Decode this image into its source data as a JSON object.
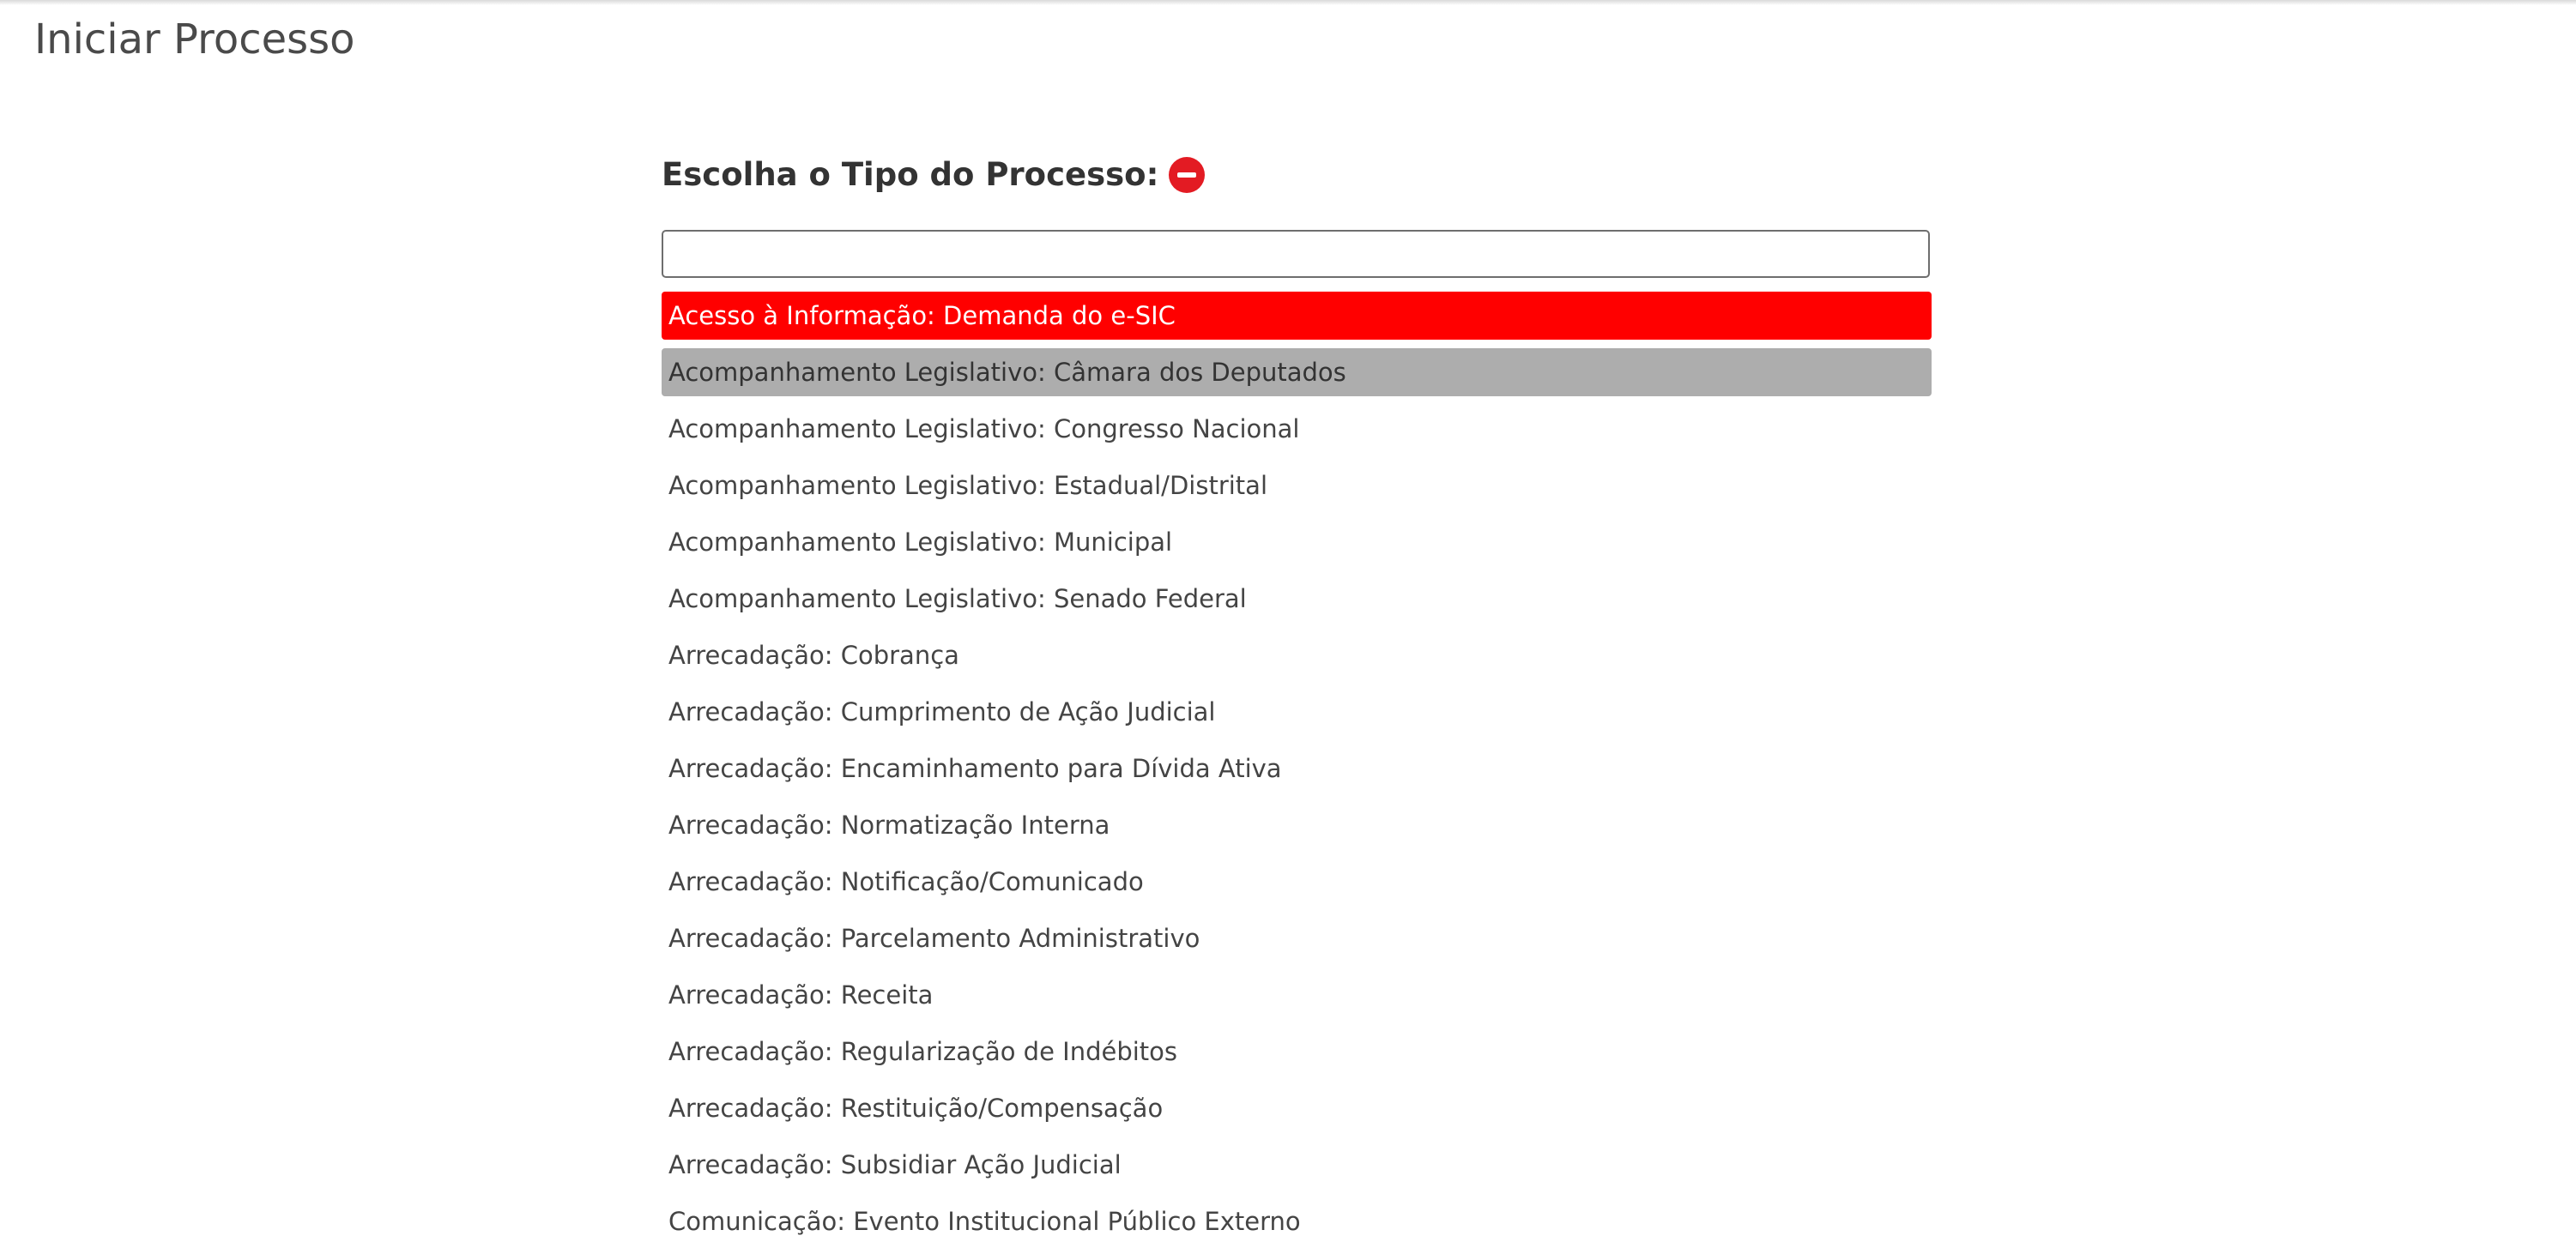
{
  "page": {
    "title": "Iniciar Processo"
  },
  "form": {
    "label": "Escolha o Tipo do Processo:",
    "toggle_icon": "minus-circle-icon",
    "search_value": "",
    "accent_color": "#ff0000",
    "hover_color": "#adadad"
  },
  "options": [
    {
      "label": "Acesso à Informação: Demanda do e-SIC",
      "state": "selected"
    },
    {
      "label": "Acompanhamento Legislativo: Câmara dos Deputados",
      "state": "hovered"
    },
    {
      "label": "Acompanhamento Legislativo: Congresso Nacional",
      "state": ""
    },
    {
      "label": "Acompanhamento Legislativo: Estadual/Distrital",
      "state": ""
    },
    {
      "label": "Acompanhamento Legislativo: Municipal",
      "state": ""
    },
    {
      "label": "Acompanhamento Legislativo: Senado Federal",
      "state": ""
    },
    {
      "label": "Arrecadação: Cobrança",
      "state": ""
    },
    {
      "label": "Arrecadação: Cumprimento de Ação Judicial",
      "state": ""
    },
    {
      "label": "Arrecadação: Encaminhamento para Dívida Ativa",
      "state": ""
    },
    {
      "label": "Arrecadação: Normatização Interna",
      "state": ""
    },
    {
      "label": "Arrecadação: Notificação/Comunicado",
      "state": ""
    },
    {
      "label": "Arrecadação: Parcelamento Administrativo",
      "state": ""
    },
    {
      "label": "Arrecadação: Receita",
      "state": ""
    },
    {
      "label": "Arrecadação: Regularização de Indébitos",
      "state": ""
    },
    {
      "label": "Arrecadação: Restituição/Compensação",
      "state": ""
    },
    {
      "label": "Arrecadação: Subsidiar Ação Judicial",
      "state": ""
    },
    {
      "label": "Comunicação: Evento Institucional Público Externo",
      "state": ""
    }
  ]
}
